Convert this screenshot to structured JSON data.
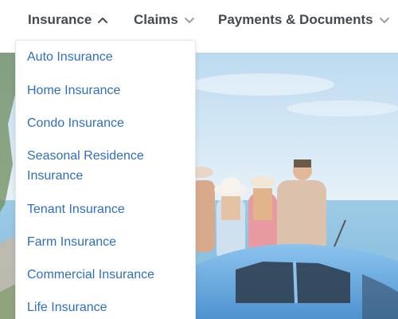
{
  "nav": {
    "items": [
      {
        "label": "Insurance",
        "expanded": true
      },
      {
        "label": "Claims",
        "expanded": false
      },
      {
        "label": "Payments & Documents",
        "expanded": false
      }
    ]
  },
  "dropdown": {
    "items": [
      {
        "label": "Auto Insurance"
      },
      {
        "label": "Home Insurance"
      },
      {
        "label": "Condo Insurance"
      },
      {
        "label": "Seasonal Residence Insurance"
      },
      {
        "label": "Tenant Insurance"
      },
      {
        "label": "Farm Insurance"
      },
      {
        "label": "Commercial Insurance"
      },
      {
        "label": "Life Insurance"
      }
    ]
  },
  "colors": {
    "nav_text": "#444a52",
    "link": "#2f6fbd",
    "sky": "#cfe4f2",
    "sea": "#8fc1df",
    "car": "#5aa0d8"
  },
  "icons": {
    "expanded": "chevron-up-icon",
    "collapsed": "chevron-down-icon"
  }
}
